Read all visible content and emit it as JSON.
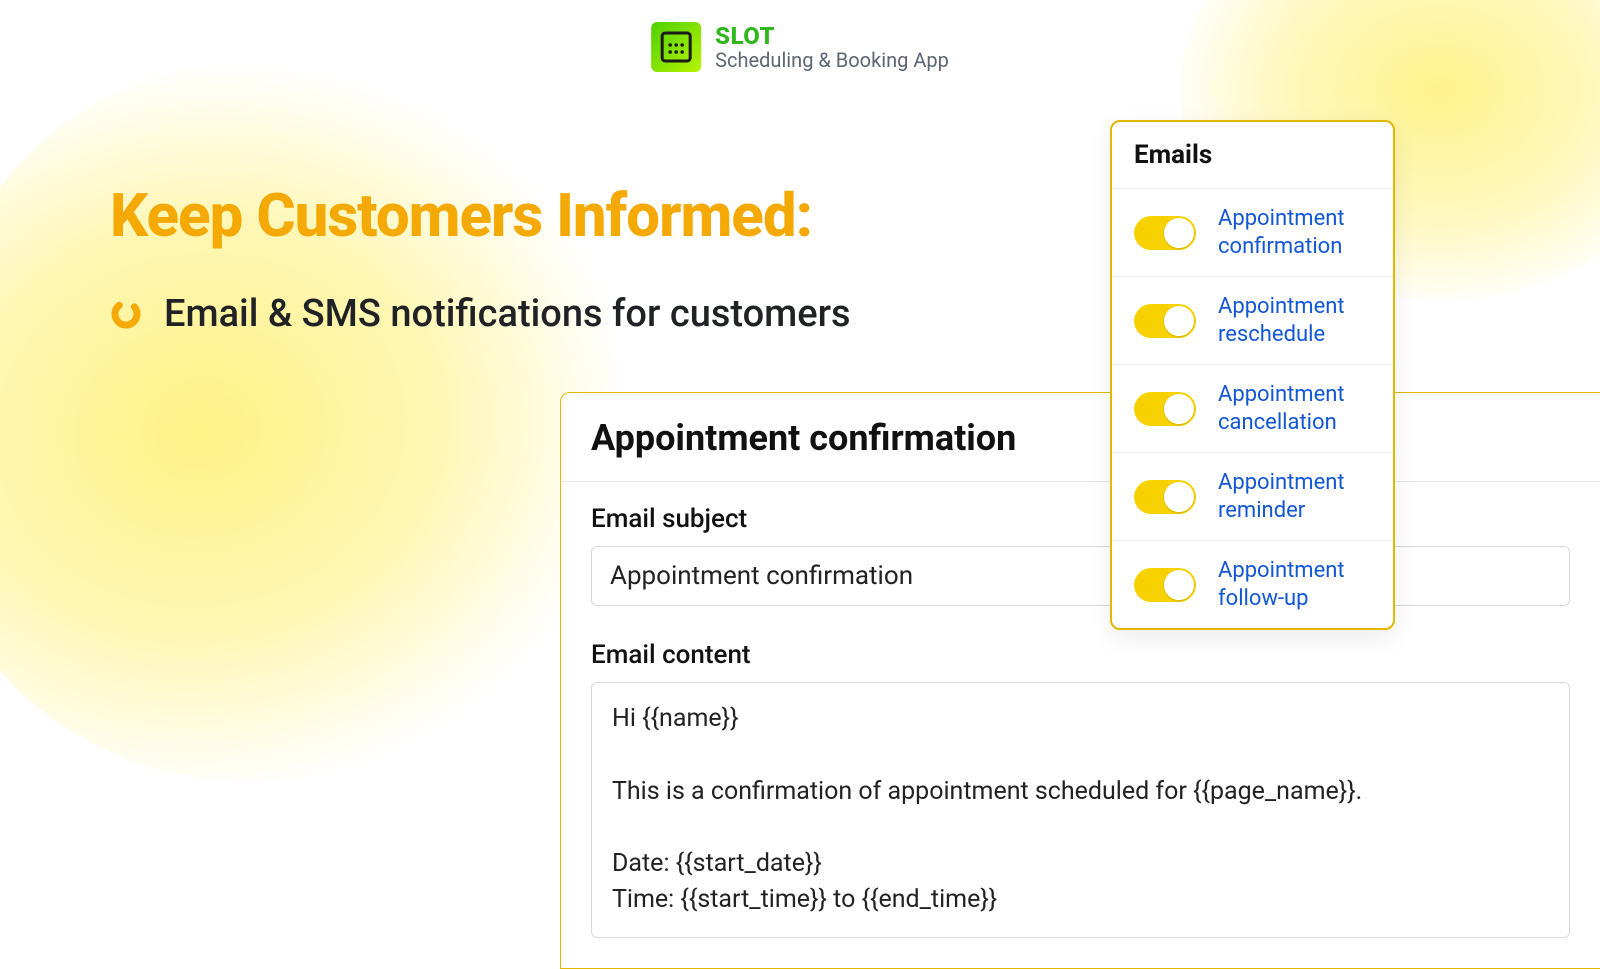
{
  "brand": {
    "name": "SLOT",
    "tagline": "Scheduling & Booking App"
  },
  "headline": "Keep Customers Informed:",
  "subline": "Email & SMS notifications for customers",
  "editor": {
    "title": "Appointment confirmation",
    "subject_label": "Email subject",
    "subject_value": "Appointment confirmation",
    "content_label": "Email content",
    "content_value": "Hi {{name}}\n\nThis is a confirmation of appointment scheduled for {{page_name}}.\n\nDate: {{start_date}}\nTime: {{start_time}} to {{end_time}}"
  },
  "emails_panel": {
    "title": "Emails",
    "items": [
      {
        "label": "Appointment confirmation",
        "on": true
      },
      {
        "label": "Appointment reschedule",
        "on": true
      },
      {
        "label": "Appointment cancellation",
        "on": true
      },
      {
        "label": "Appointment reminder",
        "on": true
      },
      {
        "label": "Appointment follow-up",
        "on": true
      }
    ]
  },
  "colors": {
    "accent": "#f5a905",
    "toggle_on": "#f7d200",
    "link": "#1257d6",
    "brand_green": "#2fb81c"
  }
}
